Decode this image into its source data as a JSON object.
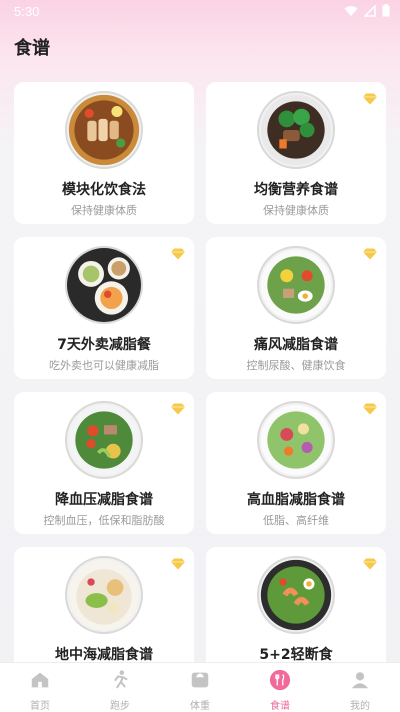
{
  "status": {
    "time": "5:30"
  },
  "page": {
    "title": "食谱"
  },
  "recipes": [
    {
      "title": "模块化饮食法",
      "subtitle": "保持健康体质",
      "vip": false,
      "image": "bowl-grilled-chicken-icon"
    },
    {
      "title": "均衡营养食谱",
      "subtitle": "保持健康体质",
      "vip": true,
      "image": "bowl-broccoli-beef-icon"
    },
    {
      "title": "7天外卖减脂餐",
      "subtitle": "吃外卖也可以健康减脂",
      "vip": true,
      "image": "takeout-dishes-icon"
    },
    {
      "title": "痛风减脂食谱",
      "subtitle": "控制尿酸、健康饮食",
      "vip": true,
      "image": "bowl-egg-salad-icon"
    },
    {
      "title": "降血压减脂食谱",
      "subtitle": "控制血压，低保和脂肪酸",
      "vip": true,
      "image": "bowl-vegetable-salad-icon"
    },
    {
      "title": "高血脂减脂食谱",
      "subtitle": "低脂、高纤维",
      "vip": true,
      "image": "bowl-fresh-salad-icon"
    },
    {
      "title": "地中海减脂食谱",
      "subtitle": "",
      "vip": true,
      "image": "bowl-avocado-icon"
    },
    {
      "title": "5+2轻断食",
      "subtitle": "",
      "vip": true,
      "image": "bowl-shrimp-egg-icon"
    }
  ],
  "vip_badge": "VIP",
  "tabs": [
    {
      "label": "首页",
      "icon": "home-icon",
      "active": false
    },
    {
      "label": "跑步",
      "icon": "running-icon",
      "active": false
    },
    {
      "label": "体重",
      "icon": "scale-icon",
      "active": false
    },
    {
      "label": "食谱",
      "icon": "cutlery-icon",
      "active": true
    },
    {
      "label": "我的",
      "icon": "profile-icon",
      "active": false
    }
  ],
  "colors": {
    "accent": "#f06a9a",
    "vip": "#f7c948"
  }
}
